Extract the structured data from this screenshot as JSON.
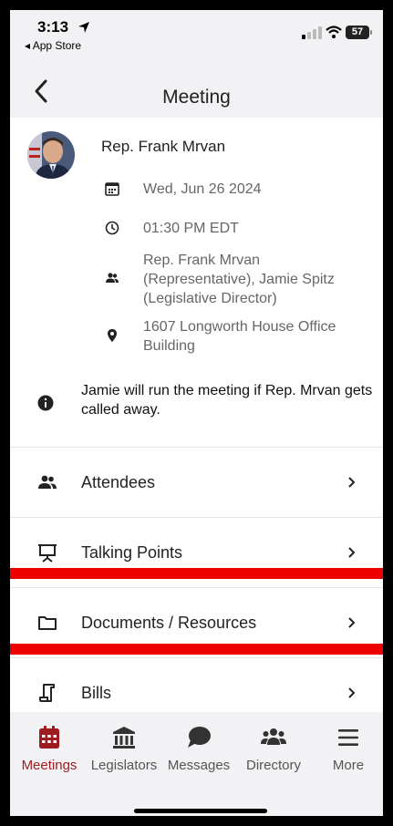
{
  "status_bar": {
    "time": "3:13",
    "back_app": "◂ App Store",
    "battery": "57"
  },
  "nav": {
    "title": "Meeting"
  },
  "meeting": {
    "rep_name": "Rep. Frank Mrvan",
    "date": "Wed, Jun 26 2024",
    "time": "01:30 PM EDT",
    "attendees_text": "Rep. Frank Mrvan (Representative), Jamie Spitz (Legislative Director)",
    "location": "1607 Longworth House Office Building",
    "note": "Jamie will run the meeting if Rep. Mrvan gets called away."
  },
  "menu": [
    {
      "label": "Attendees",
      "icon": "people-icon"
    },
    {
      "label": "Talking Points",
      "icon": "presentation-icon"
    },
    {
      "label": "Documents / Resources",
      "icon": "folder-icon"
    },
    {
      "label": "Bills",
      "icon": "scroll-icon"
    }
  ],
  "tabs": [
    {
      "label": "Meetings",
      "icon": "calendar-icon",
      "active": true
    },
    {
      "label": "Legislators",
      "icon": "capitol-icon"
    },
    {
      "label": "Messages",
      "icon": "chat-bubble-icon"
    },
    {
      "label": "Directory",
      "icon": "group-icon"
    },
    {
      "label": "More",
      "icon": "hamburger-icon"
    }
  ],
  "colors": {
    "accent": "#9e1b1f",
    "highlight_bar": "#ee0000",
    "bar_background": "#f2f2f4"
  }
}
